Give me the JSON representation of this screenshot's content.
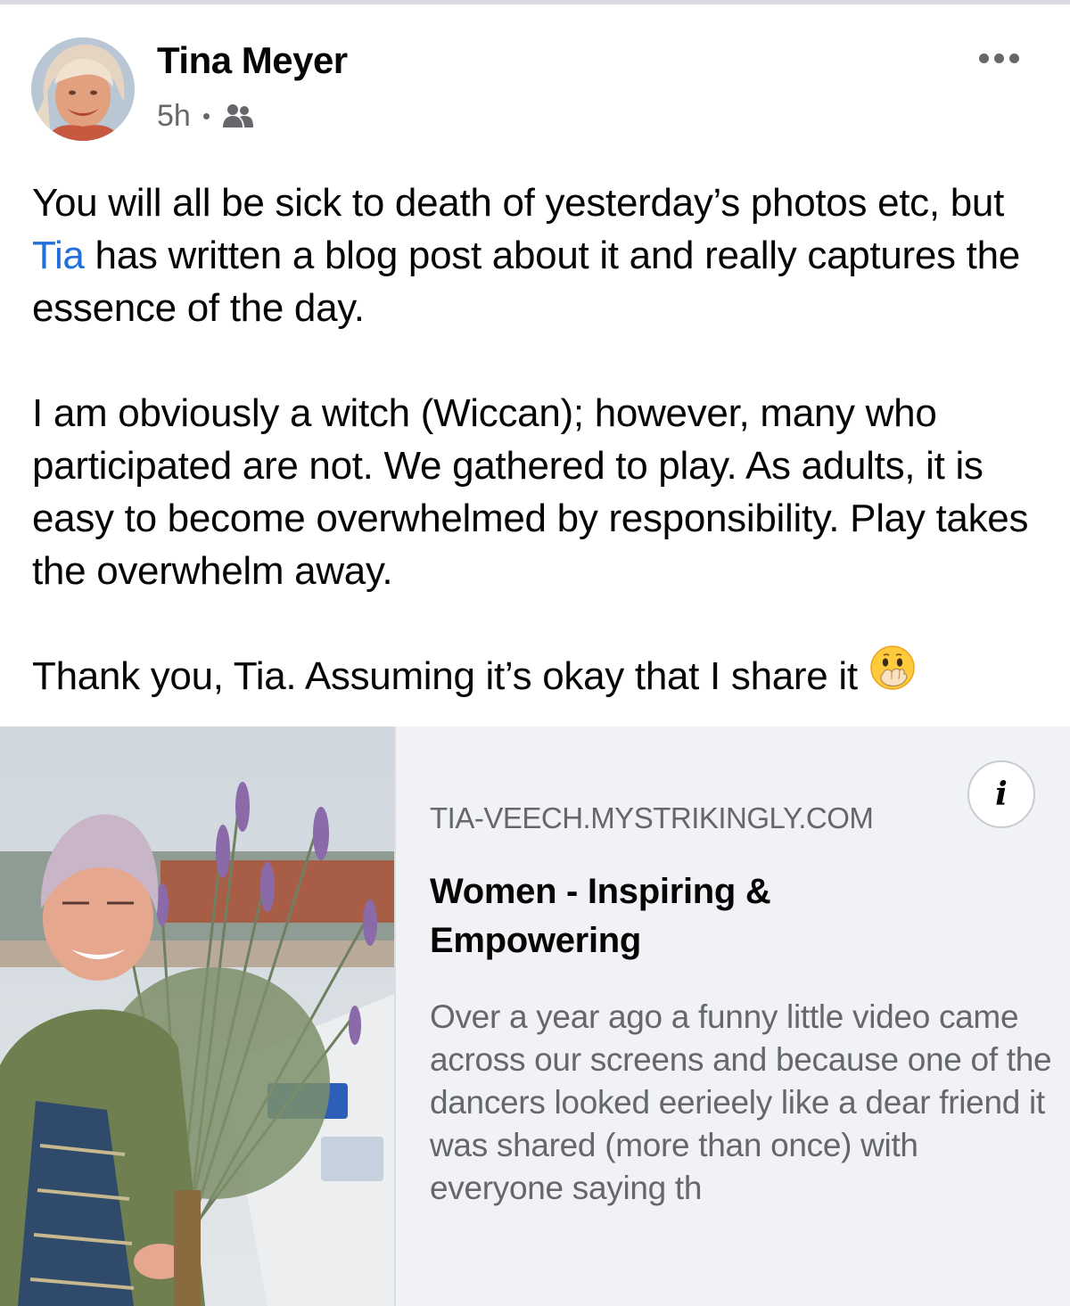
{
  "post": {
    "author": "Tina Meyer",
    "time": "5h",
    "audience_icon": "friends-icon",
    "more_icon": "more-options-icon",
    "text": {
      "p1_before": "You will all be sick to death of yesterday’s photos etc, but ",
      "p1_mention": "Tia",
      "p1_after": " has written a blog post about it and really captures the essence of the day.",
      "p2": "I am obviously a witch (Wiccan); however, many who participated are not. We gathered to play. As adults, it is easy to become overwhelmed by responsibility. Play takes the overwhelm away.",
      "p3": "Thank you, Tia. Assuming it’s okay that I share it",
      "p3_emoji": "face-with-hand-over-mouth-emoji"
    }
  },
  "link_preview": {
    "domain": "TIA-VEECH.MYSTRIKINGLY.COM",
    "title": "Women - Inspiring & Empowering",
    "description": "Over a year ago a funny little video came across our screens and because one of the dancers looked eerieely like a dear friend it was shared (more than once) with everyone saying th",
    "info_label": "i"
  },
  "colors": {
    "text": "#050505",
    "secondary": "#65676b",
    "link": "#216fdb",
    "card_bg": "#f0f2f5"
  }
}
